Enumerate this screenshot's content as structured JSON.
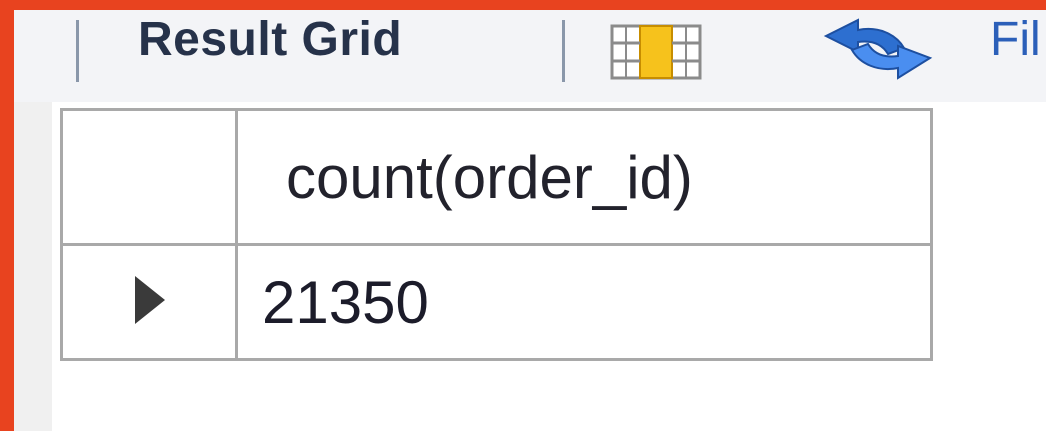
{
  "toolbar": {
    "result_grid_label": "Result Grid",
    "truncated_label": "Fil",
    "icons": [
      "grid-layout-icon",
      "refresh-icon"
    ]
  },
  "grid": {
    "columns": [
      "count(order_id)"
    ],
    "rows": [
      [
        "21350"
      ]
    ]
  },
  "colors": {
    "frame": "#e8431f",
    "toolbar_bg": "#f3f4f7",
    "grid_border": "#a9a9a9"
  }
}
